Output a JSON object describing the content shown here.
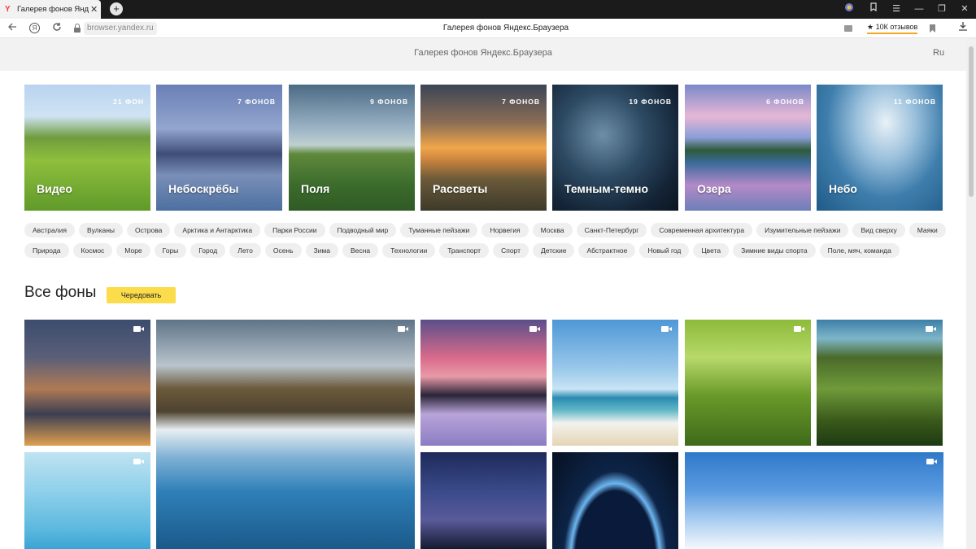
{
  "browser": {
    "tab_title": "Галерея фонов Яндекс",
    "tab_logo": "Y",
    "tab_close": "✕",
    "new_tab": "+",
    "url": "browser.yandex.ru",
    "page_title": "Галерея фонов Яндекс.Браузера",
    "reviews": "★ 10К отзывов",
    "window_controls": [
      "☰",
      "—",
      "❐",
      "✕"
    ],
    "icons": [
      "back-arrow-icon",
      "yandex-icon",
      "reload-icon",
      "lock-icon",
      "message-icon",
      "bookmark-icon",
      "download-icon"
    ]
  },
  "header": {
    "title": "Галерея фонов Яндекс.Браузера",
    "lang": "Ru"
  },
  "categories": [
    {
      "name": "Видео",
      "count": "21 ФОН"
    },
    {
      "name": "Небоскрёбы",
      "count": "7 ФОНОВ"
    },
    {
      "name": "Поля",
      "count": "9 ФОНОВ"
    },
    {
      "name": "Рассветы",
      "count": "7 ФОНОВ"
    },
    {
      "name": "Темным-темно",
      "count": "19 ФОНОВ"
    },
    {
      "name": "Озера",
      "count": "6 ФОНОВ"
    },
    {
      "name": "Небо",
      "count": "11 ФОНОВ"
    }
  ],
  "tags_row1": [
    "Австралия",
    "Вулканы",
    "Острова",
    "Арктика и Антарктика",
    "Парки России",
    "Подводный мир",
    "Туманные пейзажи",
    "Норвегия",
    "Москва",
    "Санкт-Петербург",
    "Современная архитектура",
    "Изумительные пейзажи",
    "Вид сверху",
    "Маяки"
  ],
  "tags_row2": [
    "Природа",
    "Космос",
    "Море",
    "Горы",
    "Город",
    "Лето",
    "Осень",
    "Зима",
    "Весна",
    "Технологии",
    "Транспорт",
    "Спорт",
    "Детские",
    "Абстрактное",
    "Новый год",
    "Цвета",
    "Зимние виды спорта",
    "Поле, мяч, команда"
  ],
  "all": {
    "title": "Все фоны",
    "shuffle": "Чередовать"
  },
  "colors": {
    "accent": "#fbdc4a",
    "tag_bg": "#efefef"
  }
}
